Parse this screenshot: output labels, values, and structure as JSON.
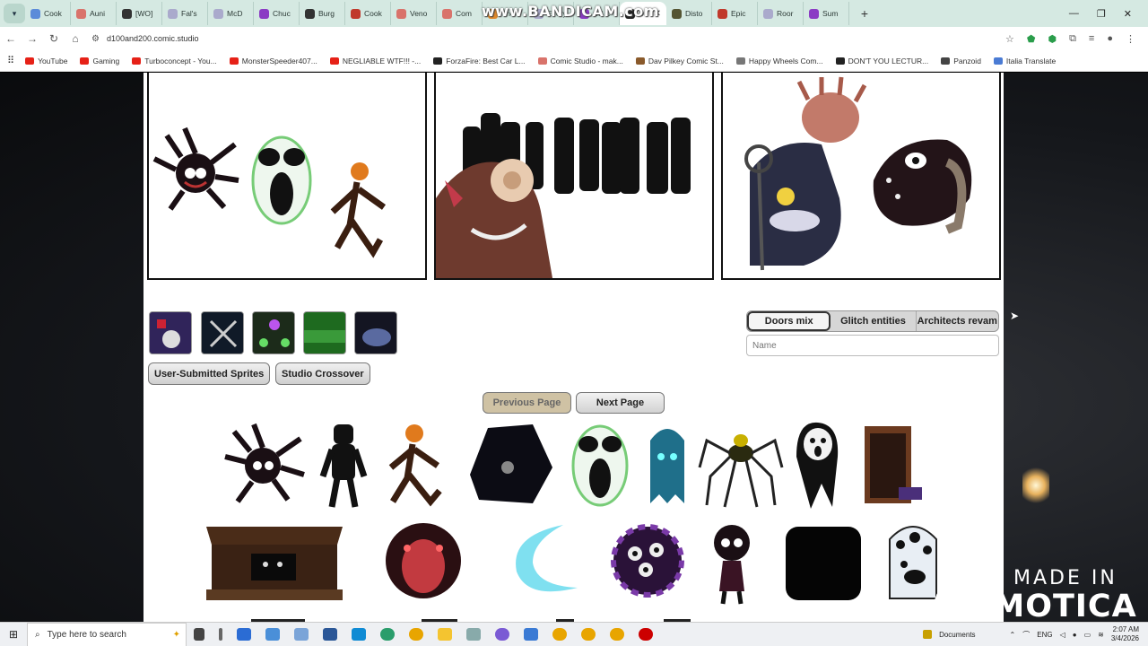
{
  "browser": {
    "tabs": [
      {
        "label": "Cook",
        "color": "#5b8bd9"
      },
      {
        "label": "Auni",
        "color": "#d9736b"
      },
      {
        "label": "[WO]",
        "color": "#333333"
      },
      {
        "label": "Fal's",
        "color": "#aac"
      },
      {
        "label": "McD",
        "color": "#aac"
      },
      {
        "label": "Chuc",
        "color": "#8b3cc4"
      },
      {
        "label": "Burg",
        "color": "#333"
      },
      {
        "label": "Cook",
        "color": "#c0392b"
      },
      {
        "label": "Veno",
        "color": "#d9736b"
      },
      {
        "label": "Com",
        "color": "#d9736b"
      },
      {
        "label": "The V",
        "color": "#e08a2d"
      },
      {
        "label": "Every",
        "color": "#aac"
      },
      {
        "label": "CS U",
        "color": "#8b3cc4"
      },
      {
        "label": "D",
        "color": "#222",
        "active": true
      },
      {
        "label": "Disto",
        "color": "#553"
      },
      {
        "label": "Epic",
        "color": "#c0392b"
      },
      {
        "label": "Roor",
        "color": "#aac"
      },
      {
        "label": "Sum",
        "color": "#8b3cc4"
      }
    ],
    "recording_watermark": "www.BANDICAM.com",
    "url": "d100and200.comic.studio",
    "bookmarks": [
      {
        "label": "YouTube",
        "color": "#e62117"
      },
      {
        "label": "Gaming",
        "color": "#e62117"
      },
      {
        "label": "Turboconcept - You...",
        "color": "#e62117"
      },
      {
        "label": "MonsterSpeeder407...",
        "color": "#e62117"
      },
      {
        "label": "NEGLIABLE WTF!!! -...",
        "color": "#e62117"
      },
      {
        "label": "ForzaFire: Best Car L...",
        "color": "#222"
      },
      {
        "label": "Comic Studio - mak...",
        "color": "#d9736b"
      },
      {
        "label": "Dav Pilkey Comic St...",
        "color": "#8a5a2b"
      },
      {
        "label": "Happy Wheels Com...",
        "color": "#777"
      },
      {
        "label": "DON'T YOU LECTUR...",
        "color": "#222"
      },
      {
        "label": "Panzoid",
        "color": "#444"
      },
      {
        "label": "Italia Translate",
        "color": "#4a7bd4"
      }
    ]
  },
  "studio": {
    "sprite_tabs": [
      "Doors mix",
      "Glitch entities",
      "Architects revam"
    ],
    "name_placeholder": "Name",
    "user_sprites_label": "User-Submitted Sprites",
    "crossover_label": "Studio Crossover",
    "prev_label": "Previous Page",
    "next_label": "Next Page"
  },
  "overlay": {
    "made_in": "MADE IN",
    "brand": "ANIMOTICA"
  },
  "taskbar": {
    "search_placeholder": "Type here to search",
    "documents_label": "Documents",
    "language": "ENG",
    "time": "2:07 AM",
    "date": "3/4/2026"
  }
}
